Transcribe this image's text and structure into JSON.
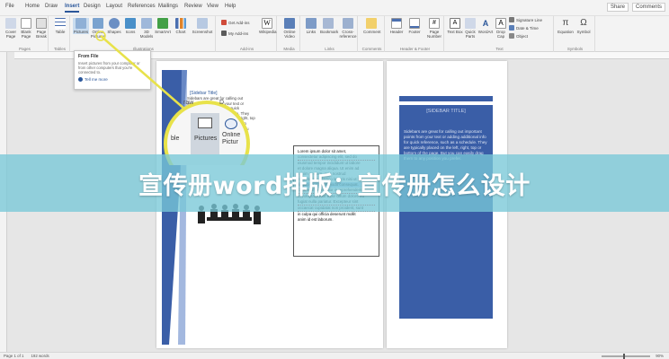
{
  "tabs": [
    "File",
    "Home",
    "Draw",
    "Insert",
    "Design",
    "Layout",
    "References",
    "Mailings",
    "Review",
    "View",
    "Help"
  ],
  "active_tab": "Insert",
  "topright": {
    "share": "Share",
    "comments": "Comments"
  },
  "ribbon": {
    "groups": [
      {
        "label": "Pages",
        "buttons": [
          "Cover Page",
          "Blank Page",
          "Page Break"
        ]
      },
      {
        "label": "Tables",
        "buttons": [
          "Table"
        ]
      },
      {
        "label": "Illustrations",
        "buttons": [
          "Pictures",
          "Online Pictures",
          "Shapes",
          "Icons",
          "3D Models",
          "SmartArt",
          "Chart",
          "Screenshot"
        ]
      },
      {
        "label": "Add-ins",
        "buttons": [
          "Get Add-ins",
          "My Add-ins",
          "Wikipedia"
        ]
      },
      {
        "label": "Media",
        "buttons": [
          "Online Video"
        ]
      },
      {
        "label": "Links",
        "buttons": [
          "Links"
        ]
      },
      {
        "label": "Comments",
        "buttons": [
          "Comment"
        ]
      },
      {
        "label": "Header & Footer",
        "buttons": [
          "Header",
          "Footer",
          "Page Number"
        ]
      },
      {
        "label": "Text",
        "buttons": [
          "Text Box",
          "Quick Parts",
          "WordArt",
          "Drop Cap"
        ],
        "small": [
          "Signature Line",
          "Date & Time",
          "Object"
        ]
      },
      {
        "label": "Symbols",
        "buttons": [
          "Equation",
          "Symbol"
        ]
      }
    ],
    "extra": [
      "Bookmark",
      "Cross-reference"
    ]
  },
  "tooltip": {
    "title": "From File",
    "desc": "Insert pictures from your computer or from other computers that you're connected to.",
    "link": "Tell me more"
  },
  "page1": {
    "sidebar_title": "[Sidebar Title]",
    "sidebar_text": "Sidebars are great for calling out important points from your text or adding additional info for quick reference, such as a schedule. They are typically placed on the left, right, top or bottom of the page. But you can easily drag them to any position you prefer."
  },
  "zoom": {
    "left": "ble",
    "pictures": "Pictures",
    "online": "Online Pictur",
    "top": "raw",
    "top2": "D"
  },
  "textbox_lines": [
    "Lorem ipsum dolor sit amet,",
    "consectetur adipiscing elit, sed do",
    "eiusmod tempor incididunt ut labore",
    "et dolore magna aliqua. Ut enim ad",
    "minim veniam, quis nostrud",
    "exercitation ullamco laboris nisi ut",
    "aliquip ex ea commodo consequat.",
    "Duis aute irure dolor in reprehenderit",
    "in voluptate velit esse cillum dolore eu",
    "fugiat nulla pariatur. Excepteur sint",
    "occaecat cupidatat non proident, sunt",
    "in culpa qui officia deserunt mollit",
    "anim id est laborum."
  ],
  "page2": {
    "title": "[SIDEBAR TITLE]",
    "text": "Sidebars are great for calling out important points from your text or adding additional info for quick reference, such as a schedule. They are typically placed on the left, right, top or bottom of the page. But you can easily drag them to any position you prefer."
  },
  "banner": "宣传册word排版：宣传册怎么设计",
  "status": {
    "page": "Page 1 of 1",
    "words": "192 words",
    "zoom": "90%"
  },
  "colors": {
    "accent": "#2b579a",
    "sidebar": "#3a5ea7",
    "highlight": "#e8e24a"
  }
}
